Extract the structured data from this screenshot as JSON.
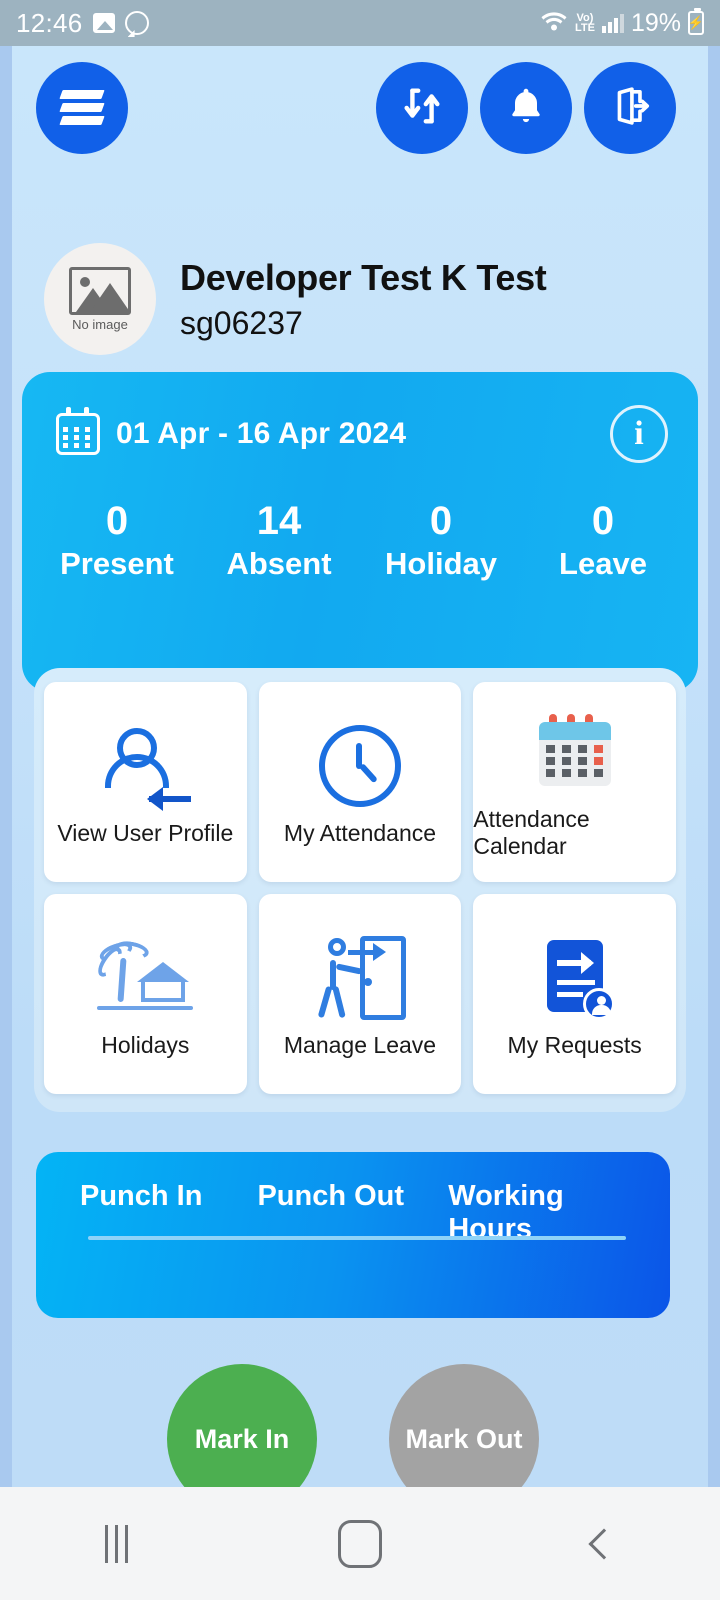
{
  "status_bar": {
    "time": "12:46",
    "battery_percent": "19%",
    "network_label": "Vo)",
    "network_sub": "LTE",
    "icons": [
      "gallery-icon",
      "whatsapp-icon",
      "wifi-icon",
      "volte-icon",
      "signal-icon",
      "battery-icon"
    ]
  },
  "header": {
    "logo_label": "app-logo",
    "actions": [
      {
        "name": "sync-button",
        "icon": "sync-icon"
      },
      {
        "name": "notifications-button",
        "icon": "bell-icon"
      },
      {
        "name": "logout-button",
        "icon": "logout-icon"
      }
    ]
  },
  "profile": {
    "avatar_placeholder": "No image",
    "name": "Developer Test K Test",
    "employee_id": "sg06237"
  },
  "summary": {
    "date_range": "01 Apr  - 16 Apr 2024",
    "info_icon": "i",
    "stats": [
      {
        "value": "0",
        "label": "Present"
      },
      {
        "value": "14",
        "label": "Absent"
      },
      {
        "value": "0",
        "label": "Holiday"
      },
      {
        "value": "0",
        "label": "Leave"
      }
    ]
  },
  "tiles": [
    {
      "label": "View User Profile",
      "icon": "user-profile-icon"
    },
    {
      "label": "My Attendance",
      "icon": "clock-icon"
    },
    {
      "label": "Attendance Calendar",
      "icon": "calendar-icon"
    },
    {
      "label": "Holidays",
      "icon": "palm-house-icon"
    },
    {
      "label": "Manage Leave",
      "icon": "person-exit-icon"
    },
    {
      "label": "My Requests",
      "icon": "document-request-icon"
    }
  ],
  "punch_card": {
    "columns": [
      {
        "label": "Punch In",
        "value": ""
      },
      {
        "label": "Punch Out",
        "value": ""
      },
      {
        "label": "Working Hours",
        "value": ""
      }
    ]
  },
  "mark_buttons": {
    "mark_in": "Mark In",
    "mark_out": "Mark Out"
  },
  "nav_bar": {
    "recents": "recents-icon",
    "home": "home-icon",
    "back": "back-icon"
  },
  "colors": {
    "primary_blue": "#1160e8",
    "card_cyan": "#12a9f0",
    "punch_gradient_start": "#04b4f5",
    "punch_gradient_end": "#0b55e8",
    "mark_in_green": "#4caf50",
    "mark_out_gray": "#a3a3a3",
    "background": "#c6e2fa"
  }
}
